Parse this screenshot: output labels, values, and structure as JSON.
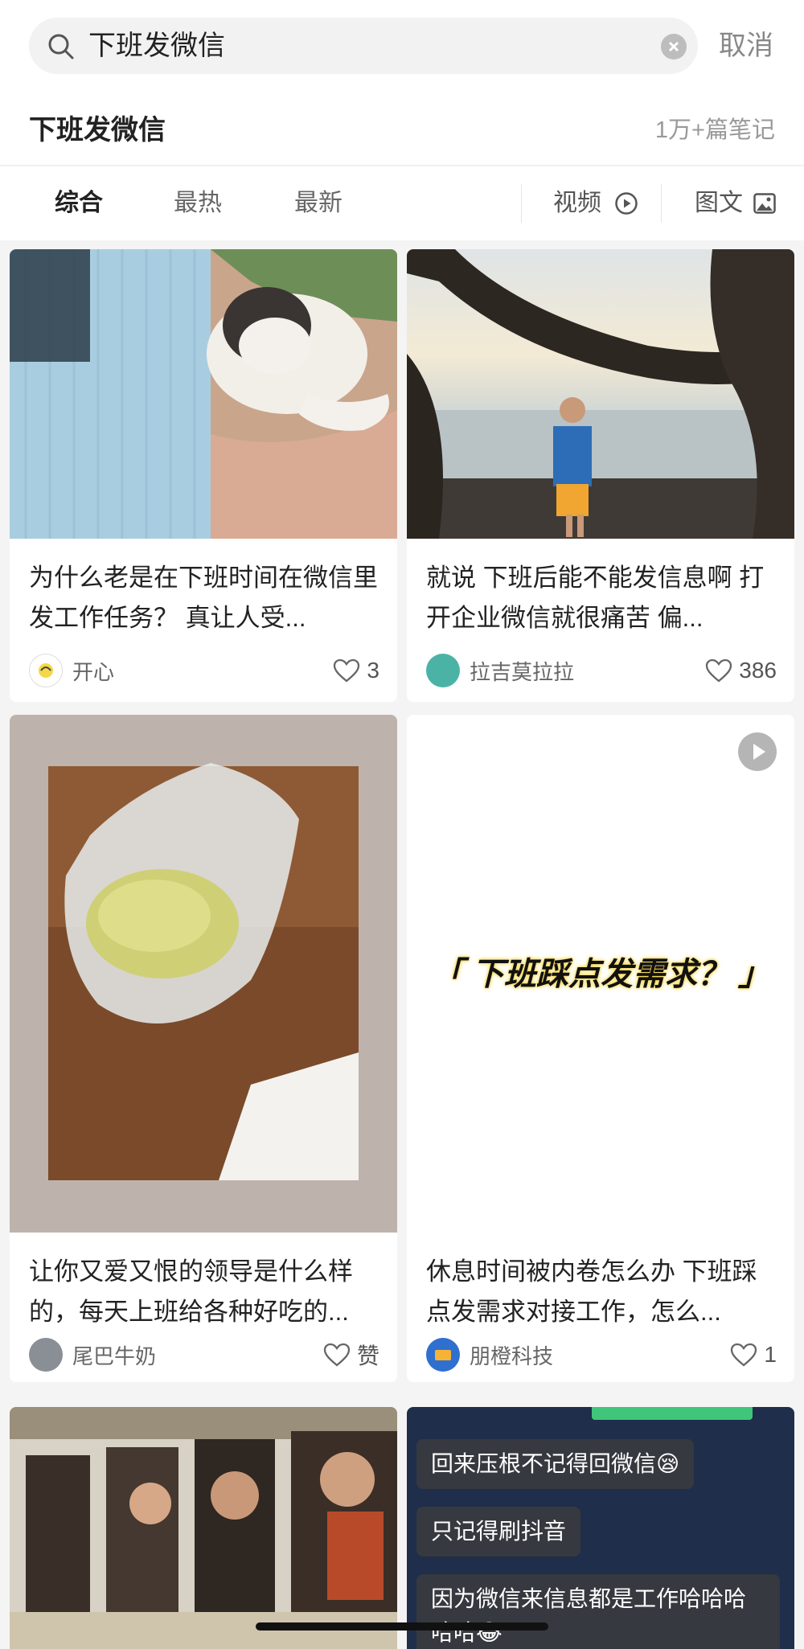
{
  "search": {
    "query": "下班发微信",
    "cancel_label": "取消"
  },
  "header": {
    "title": "下班发微信",
    "count": "1万+篇笔记"
  },
  "filters": {
    "tabs": [
      {
        "label": "综合",
        "active": true
      },
      {
        "label": "最热",
        "active": false
      },
      {
        "label": "最新",
        "active": false
      }
    ],
    "video_label": "视频",
    "image_label": "图文"
  },
  "cards": [
    {
      "title": "为什么老是在下班时间在微信里发工作任务？ 真让人受...",
      "author": "开心",
      "likes": "3"
    },
    {
      "title": "就说 下班后能不能发信息啊 打开企业微信就很痛苦 偏...",
      "author": "拉吉莫拉拉",
      "likes": "386"
    },
    {
      "title": "让你又爱又恨的领导是什么样的，每天上班给各种好吃的...",
      "author": "尾巴牛奶",
      "likes": "赞"
    },
    {
      "title": "休息时间被内卷怎么办 下班踩点发需求对接工作，怎么...",
      "author": "朋橙科技",
      "likes": "1",
      "image_caption": "「 下班踩点发需求？ 」"
    },
    {
      "title": "",
      "author": "",
      "likes": ""
    },
    {
      "title": "",
      "author": "",
      "likes": "",
      "chat_lines": [
        "回来压根不记得回微信😪",
        "只记得刷抖音",
        "因为微信来信息都是工作哈哈哈哈哈😂"
      ]
    }
  ],
  "colors": {
    "accent": "#222222",
    "muted": "#999999",
    "background": "#f4f4f4"
  }
}
